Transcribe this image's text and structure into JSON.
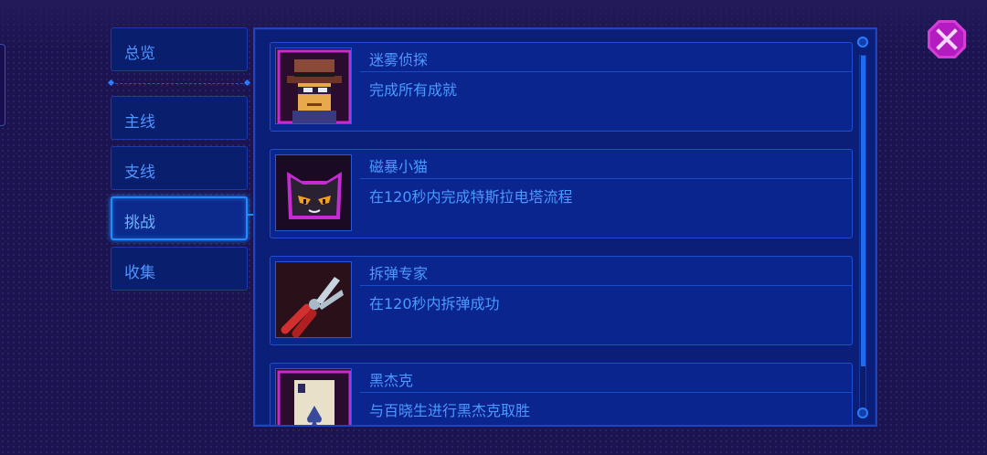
{
  "sidebar": {
    "items": [
      {
        "label": "总览",
        "active": false
      },
      {
        "label": "主线",
        "active": false
      },
      {
        "label": "支线",
        "active": false
      },
      {
        "label": "挑战",
        "active": true
      },
      {
        "label": "收集",
        "active": false
      }
    ]
  },
  "achievements": [
    {
      "title": "迷雾侦探",
      "description": "完成所有成就",
      "icon": "detective-icon"
    },
    {
      "title": "磁暴小猫",
      "description": "在120秒内完成特斯拉电塔流程",
      "icon": "black-cat-icon"
    },
    {
      "title": "拆弹专家",
      "description": "在120秒内拆弹成功",
      "icon": "pliers-icon"
    },
    {
      "title": "黑杰克",
      "description": "与百晓生进行黑杰克取胜",
      "icon": "jack-spades-card-icon"
    }
  ],
  "close_button": {
    "icon": "close-icon"
  },
  "colors": {
    "accent": "#1f8cff",
    "text": "#4c98ff",
    "card_bg": "#0a268e",
    "close": "#d23ed6"
  }
}
